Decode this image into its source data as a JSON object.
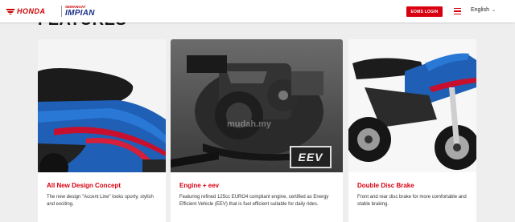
{
  "header": {
    "brand": "HONDA",
    "tagline_top": "SEMANGAT",
    "tagline_main": "IMPIAN",
    "eoms_button": "EOMS LOGIN",
    "menu_icon": "hamburger-menu-icon",
    "language": "English",
    "accent_color": "#d9000f"
  },
  "section": {
    "title": "FEATURES"
  },
  "cards": [
    {
      "title": "All New Design Concept",
      "description": "The new design \"Accent Line\" looks sporty, stylish and exciting."
    },
    {
      "title": "Engine + eev",
      "description": "Featuring refined 125cc EURO4 compliant engine, certified as Energy Efficient Vehicle (EEV) that is fuel efficient suitable for daily rides.",
      "watermark": "mudah.my",
      "badge": "EEV"
    },
    {
      "title": "Double Disc Brake",
      "description": "Front and rear disc brake for more comfortable and stable braking."
    }
  ]
}
